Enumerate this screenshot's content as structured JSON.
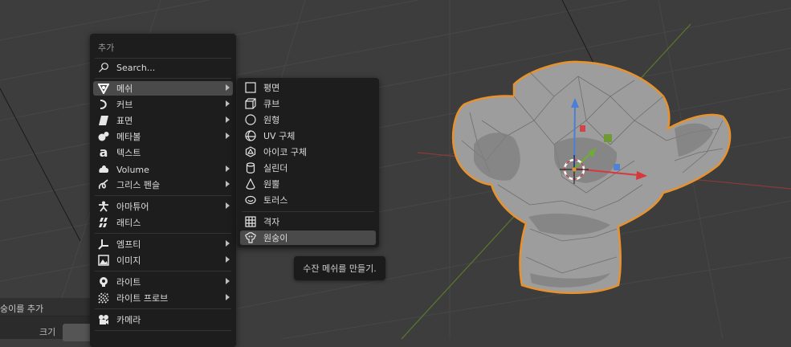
{
  "add_menu": {
    "title": "추가",
    "search_label": "Search...",
    "items": [
      {
        "label": "메쉬",
        "icon": "mesh-icon"
      },
      {
        "label": "커브",
        "icon": "curve-icon"
      },
      {
        "label": "표면",
        "icon": "surface-icon"
      },
      {
        "label": "메타볼",
        "icon": "metaball-icon"
      },
      {
        "label": "텍스트",
        "icon": "text-icon"
      },
      {
        "label": "Volume",
        "icon": "volume-icon"
      },
      {
        "label": "그리스 펜슬",
        "icon": "grease-pencil-icon"
      },
      {
        "label": "아마튜어",
        "icon": "armature-icon"
      },
      {
        "label": "래티스",
        "icon": "lattice-icon"
      },
      {
        "label": "엠프티",
        "icon": "empty-icon"
      },
      {
        "label": "이미지",
        "icon": "image-icon"
      },
      {
        "label": "라이트",
        "icon": "light-icon"
      },
      {
        "label": "라이트 프로브",
        "icon": "light-probe-icon"
      },
      {
        "label": "카메라",
        "icon": "camera-icon"
      }
    ]
  },
  "mesh_submenu": {
    "items": [
      {
        "label": "평면",
        "icon": "plane-icon"
      },
      {
        "label": "큐브",
        "icon": "cube-icon"
      },
      {
        "label": "원형",
        "icon": "circle-icon"
      },
      {
        "label": "UV 구체",
        "icon": "uv-sphere-icon"
      },
      {
        "label": "아이코 구체",
        "icon": "ico-sphere-icon"
      },
      {
        "label": "실린더",
        "icon": "cylinder-icon"
      },
      {
        "label": "원뿔",
        "icon": "cone-icon"
      },
      {
        "label": "토러스",
        "icon": "torus-icon"
      },
      {
        "label": "격자",
        "icon": "grid-icon"
      },
      {
        "label": "원숭이",
        "icon": "monkey-icon"
      }
    ]
  },
  "tooltip": {
    "text": "수잔 메쉬를 만들기."
  },
  "operator_panel": {
    "title": "숭이를 추가",
    "size_label": "크기"
  },
  "colors": {
    "menu_bg": "#1d1d1d",
    "highlight": "#4a4a4a",
    "viewport_bg": "#3d3d3d",
    "selection_outline": "#e8922e",
    "axis_x": "#d9363e",
    "axis_y": "#6a9a2a",
    "gizmo_z": "#4a7fd9"
  }
}
